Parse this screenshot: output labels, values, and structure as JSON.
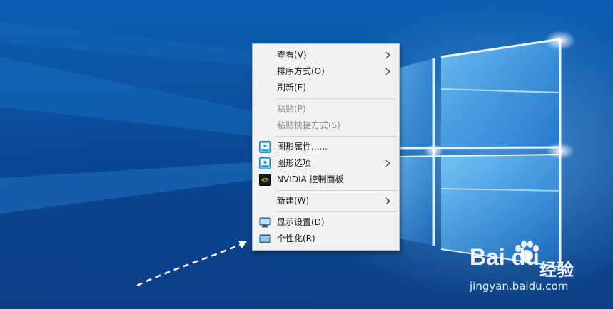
{
  "menu": {
    "items": [
      {
        "label": "查看(V)",
        "submenu": true,
        "enabled": true
      },
      {
        "label": "排序方式(O)",
        "submenu": true,
        "enabled": true
      },
      {
        "label": "刷新(E)",
        "submenu": false,
        "enabled": true
      },
      {
        "label": "粘贴(P)",
        "submenu": false,
        "enabled": false
      },
      {
        "label": "粘贴快捷方式(S)",
        "submenu": false,
        "enabled": false
      },
      {
        "label": "图形属性......",
        "submenu": false,
        "enabled": true,
        "icon": "intel-graphics-icon"
      },
      {
        "label": "图形选项",
        "submenu": true,
        "enabled": true,
        "icon": "intel-graphics-icon"
      },
      {
        "label": "NVIDIA 控制面板",
        "submenu": false,
        "enabled": true,
        "icon": "nvidia-icon"
      },
      {
        "label": "新建(W)",
        "submenu": true,
        "enabled": true
      },
      {
        "label": "显示设置(D)",
        "submenu": false,
        "enabled": true,
        "icon": "monitor-icon"
      },
      {
        "label": "个性化(R)",
        "submenu": false,
        "enabled": true,
        "icon": "personalize-icon"
      }
    ]
  },
  "watermark": {
    "logo_text": "Bai du",
    "logo_suffix": "经验",
    "url": "jingyan.baidu.com"
  },
  "colors": {
    "desktop_blue": "#0b4f9c",
    "menu_bg": "#f2f2f2",
    "disabled_text": "#8d8d8d"
  }
}
